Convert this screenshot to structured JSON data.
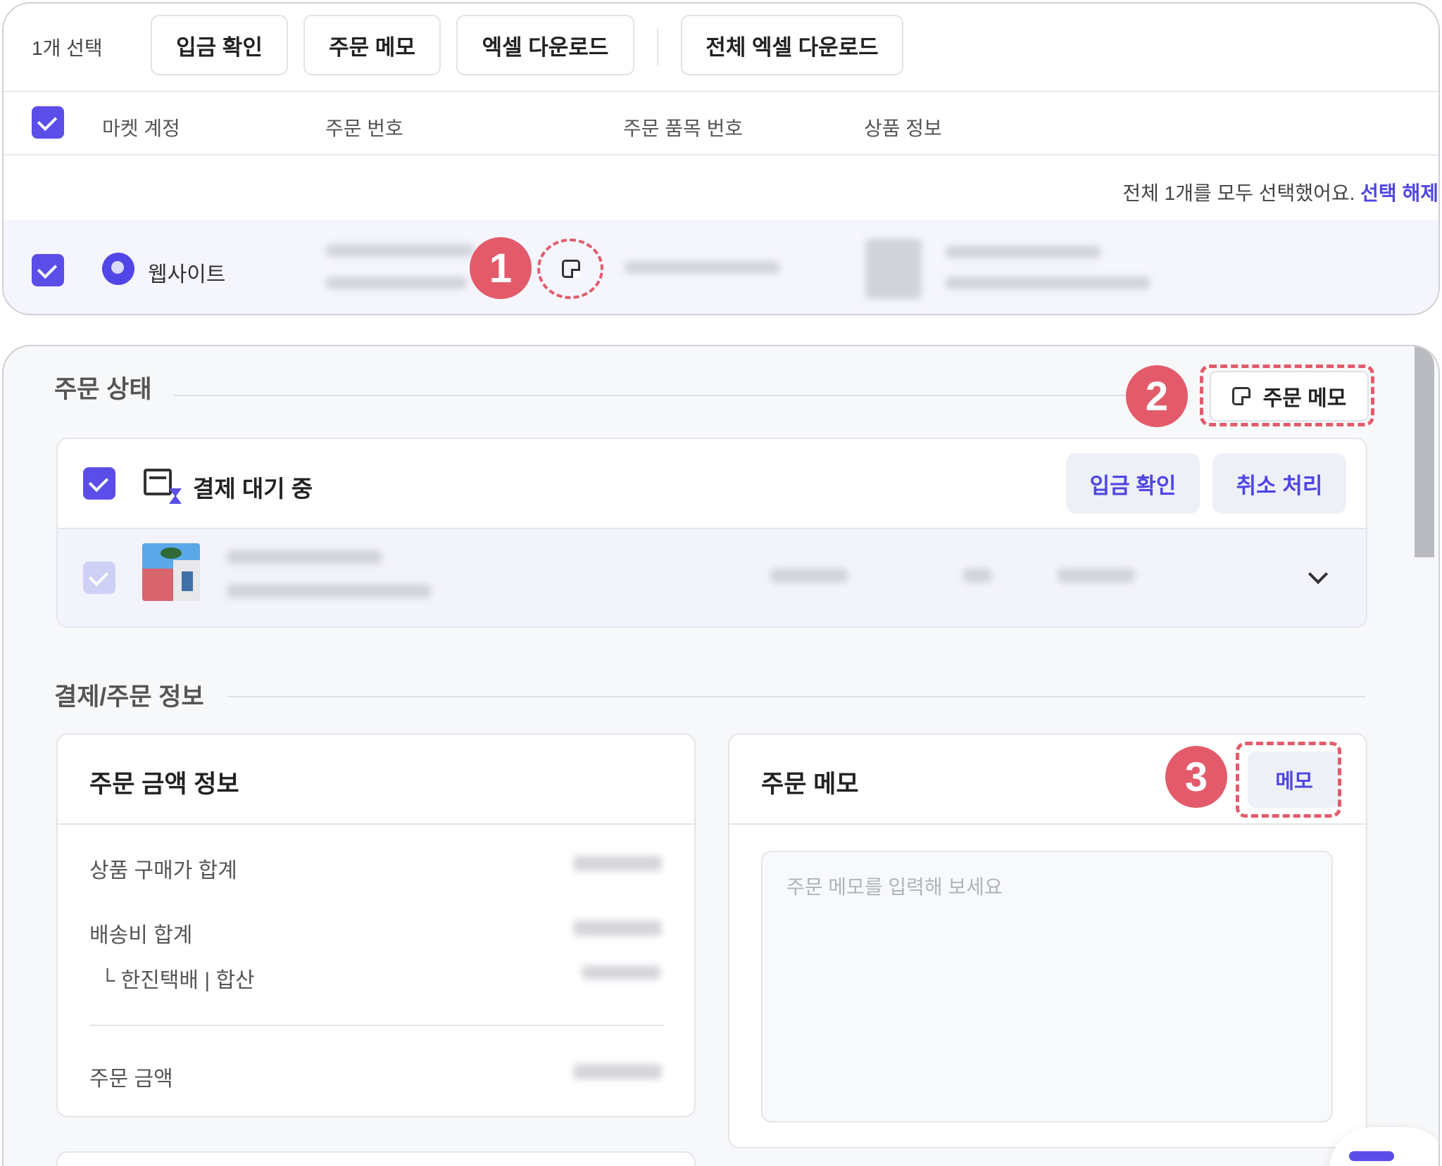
{
  "toolbar": {
    "selected_count": "1개 선택",
    "deposit_confirm": "입금 확인",
    "order_memo": "주문 메모",
    "excel_download": "엑셀 다운로드",
    "all_excel_download": "전체 엑셀 다운로드"
  },
  "table": {
    "headers": [
      "마켓 계정",
      "주문 번호",
      "주문 품목 번호",
      "상품 정보"
    ],
    "select_all_notice": "전체 1개를 모두 선택했어요.",
    "deselect_link": "선택 해제",
    "row": {
      "market": "웹사이트",
      "market_icon": "website-icon"
    }
  },
  "markers": [
    "1",
    "2",
    "3"
  ],
  "detail": {
    "order_status_title": "주문 상태",
    "order_memo_button": "주문 메모",
    "status": {
      "label": "결제 대기 중",
      "icon": "payment-pending-icon",
      "deposit_confirm": "입금 확인",
      "cancel": "취소 처리"
    },
    "payment_section_title": "결제/주문 정보",
    "amount_card": {
      "title": "주문 금액 정보",
      "items": {
        "product_total": "상품 구매가 합계",
        "shipping_total": "배송비 합계",
        "courier": "└ 한진택배 | 합산",
        "order_amount": "주문 금액"
      }
    },
    "memo_card": {
      "title": "주문 메모",
      "memo_button": "메모",
      "placeholder": "주문 메모를 입력해 보세요"
    }
  },
  "colors": {
    "accent": "#5b4ee8",
    "highlight": "#e35b6a",
    "link": "#4f45e4"
  }
}
